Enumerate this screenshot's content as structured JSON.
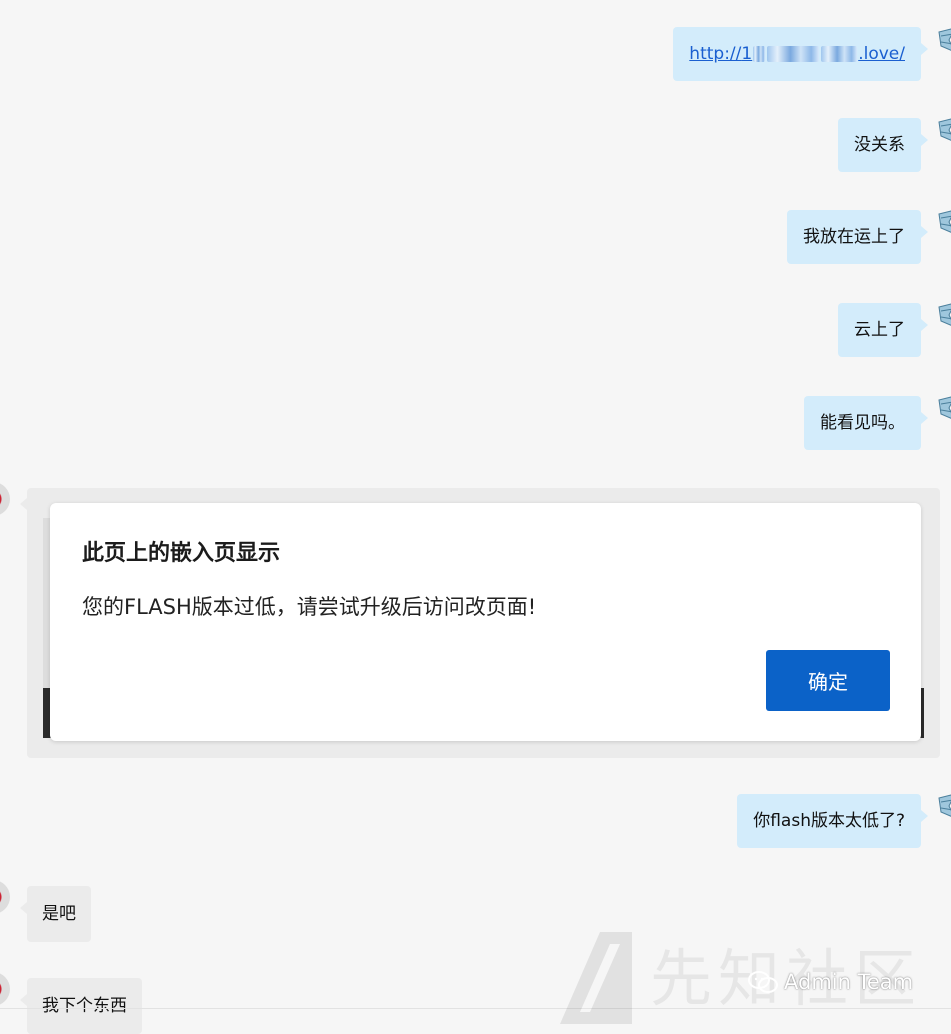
{
  "messages_right": [
    {
      "text": "http://",
      "text_end": ".love/",
      "is_link": true
    },
    {
      "text": "没关系"
    },
    {
      "text": "我放在运上了"
    },
    {
      "text": "云上了"
    },
    {
      "text": "能看见吗。"
    },
    {
      "text": "你flash版本太低了?"
    }
  ],
  "dialog": {
    "title": "此页上的嵌入页显示",
    "message": "您的FLASH版本过低，请尝试升级后访问改页面!",
    "button_label": "确定"
  },
  "messages_left": [
    {
      "text": "是吧"
    },
    {
      "text": "我下个东西"
    }
  ],
  "watermark": {
    "site_text": "先知社区",
    "account": "Admin Team"
  },
  "colors": {
    "bubble_right": "#d3ecfb",
    "bubble_left": "#ebebeb",
    "button": "#0b62c8",
    "link": "#1a5fd0"
  }
}
